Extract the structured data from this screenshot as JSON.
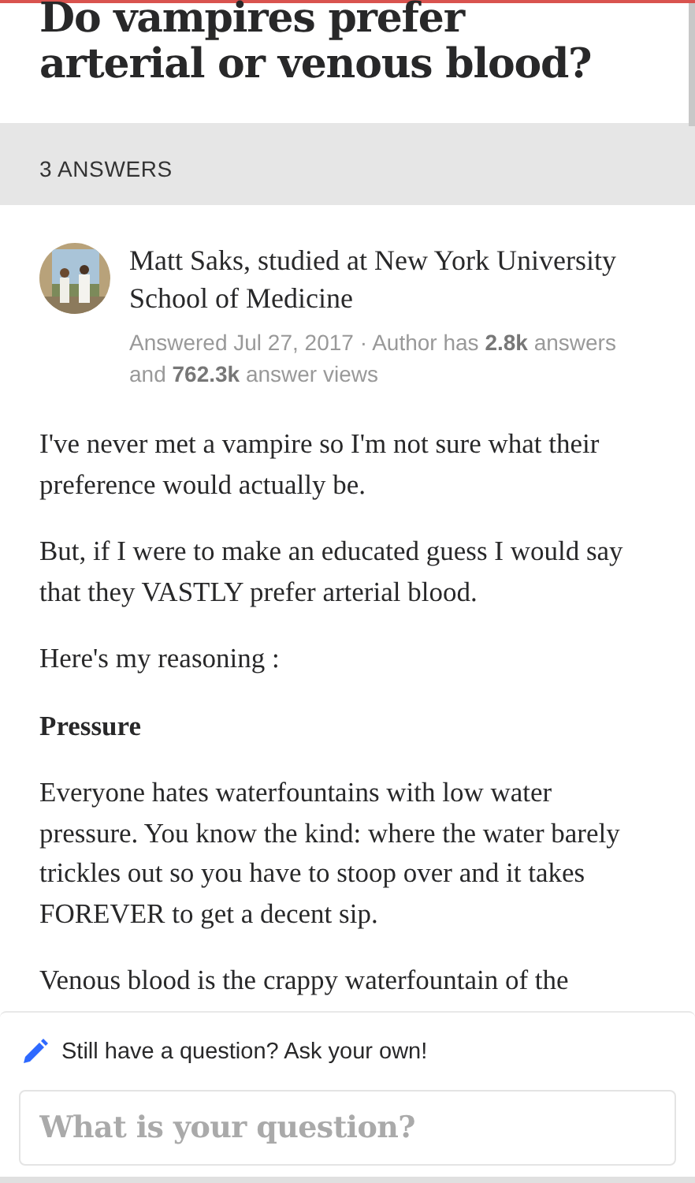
{
  "question": {
    "title": "Do vampires prefer arterial or venous blood?"
  },
  "answers_header": {
    "label": "3 ANSWERS"
  },
  "answer": {
    "author": "Matt Saks, studied at New York University School of Medicine",
    "meta": "Answered Jul 27, 2017 · Author has **2.8k** answers and **762.3k** answer views",
    "paragraphs": [
      {
        "kind": "text",
        "text": "I've never met a vampire so I'm not sure what their preference would actually be."
      },
      {
        "kind": "text",
        "text": "But, if I were to make an educated guess I would say that they VASTLY prefer arterial blood."
      },
      {
        "kind": "text",
        "text": "Here's my reasoning :"
      },
      {
        "kind": "heading",
        "text": "Pressure"
      },
      {
        "kind": "text",
        "text": "Everyone hates waterfountains with low water pressure. You know the kind: where the water barely trickles out so you have to stoop over and it takes FOREVER to get a decent sip."
      },
      {
        "kind": "text",
        "text": "Venous blood is the crappy waterfountain of the"
      }
    ]
  },
  "ask_panel": {
    "prompt": "Still have a question? Ask your own!",
    "input": {
      "placeholder": "What is your question?"
    }
  }
}
